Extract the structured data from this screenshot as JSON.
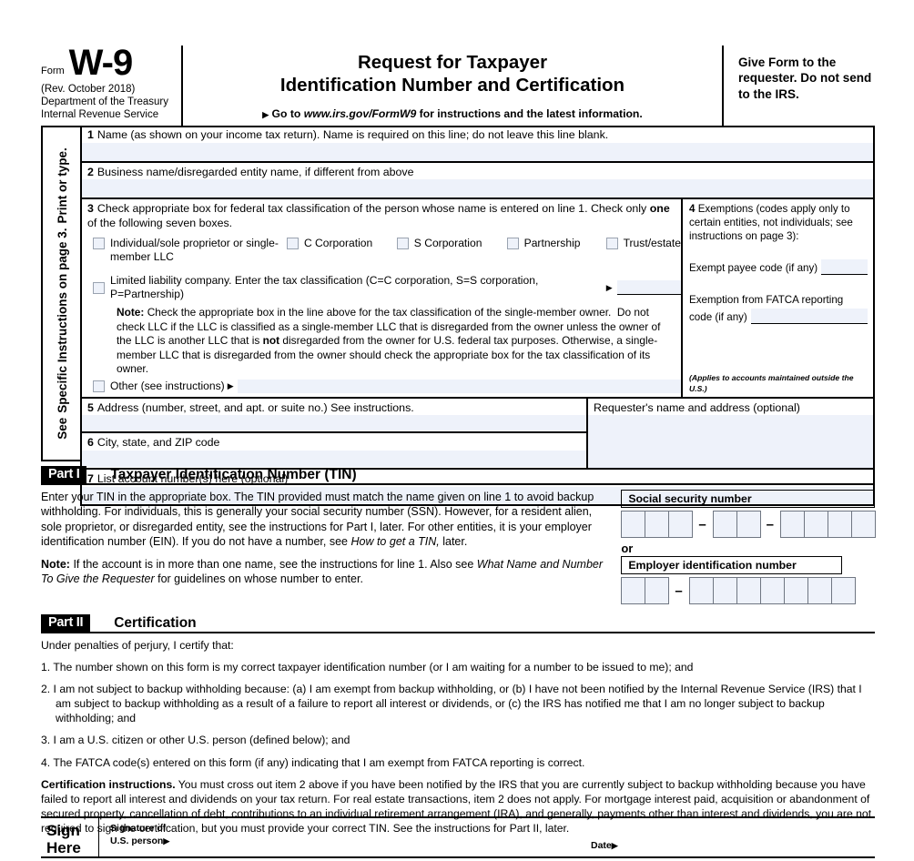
{
  "header": {
    "form_word": "Form",
    "form_number": "W-9",
    "revision": "(Rev. October 2018)",
    "dept_line1": "Department of the Treasury",
    "dept_line2": "Internal Revenue Service",
    "title_line1": "Request for Taxpayer",
    "title_line2": "Identification Number and Certification",
    "goto_prefix": "Go to",
    "goto_url": "www.irs.gov/FormW9",
    "goto_suffix": "for instructions and the latest information.",
    "give_form_note": "Give Form to the requester. Do not send to the IRS."
  },
  "sidebar": {
    "line1": "Print or type.",
    "line2_prefix": "See",
    "line2": "Specific Instructions on page 3."
  },
  "line1": {
    "number": "1",
    "label": "Name (as shown on your income tax return). Name is required on this line; do not leave this line blank.",
    "value": ""
  },
  "line2": {
    "number": "2",
    "label": "Business name/disregarded entity name, if different from above",
    "value": ""
  },
  "line3": {
    "number": "3",
    "label": "Check appropriate box for federal tax classification of the person whose name is entered on line 1. Check only one of the following seven boxes.",
    "label_bold_word": "one",
    "checkboxes": [
      {
        "name": "individual",
        "label": "Individual/sole proprietor or single-member LLC",
        "checked": false
      },
      {
        "name": "c-corporation",
        "label": "C Corporation",
        "checked": false
      },
      {
        "name": "s-corporation",
        "label": "S Corporation",
        "checked": false
      },
      {
        "name": "partnership",
        "label": "Partnership",
        "checked": false
      },
      {
        "name": "trust-estate",
        "label": "Trust/estate",
        "checked": false
      }
    ],
    "llc": {
      "label": "Limited liability company. Enter the tax classification (C=C corporation, S=S corporation, P=Partnership)",
      "checked": false,
      "value": ""
    },
    "note_label": "Note:",
    "note_text": "Check the appropriate box in the line above for the tax classification of the single-member owner.  Do not check LLC if the LLC is classified as a single-member LLC that is disregarded from the owner unless the owner of the LLC is another LLC that is not disregarded from the owner for U.S. federal tax purposes. Otherwise, a single-member LLC that is disregarded from the owner should check the appropriate box for the tax classification of its owner.",
    "other": {
      "label": "Other (see instructions)",
      "checked": false,
      "value": ""
    }
  },
  "line4": {
    "number": "4",
    "label": "Exemptions (codes apply only to certain entities, not individuals; see instructions on page 3):",
    "exempt_payee_label": "Exempt payee code (if any)",
    "exempt_payee_value": "",
    "fatca_label_line1": "Exemption from FATCA reporting",
    "fatca_label_line2": "code (if any)",
    "fatca_value": "",
    "footnote": "(Applies to accounts maintained outside the U.S.)"
  },
  "line5": {
    "number": "5",
    "label": "Address (number, street, and apt. or suite no.) See instructions.",
    "value": ""
  },
  "line6": {
    "number": "6",
    "label": "City, state, and ZIP code",
    "value": ""
  },
  "requester": {
    "label": "Requester's name and address (optional)",
    "value": ""
  },
  "line7": {
    "number": "7",
    "label": "List account number(s) here (optional)",
    "value": ""
  },
  "part1": {
    "tag": "Part I",
    "title": "Taxpayer Identification Number (TIN)",
    "para1": "Enter your TIN in the appropriate box. The TIN provided must match the name given on line 1 to avoid backup withholding. For individuals, this is generally your social security number (SSN). However, for a resident alien, sole proprietor, or disregarded entity, see the instructions for Part I, later. For other entities, it is your employer identification number (EIN). If you do not have a number, see",
    "para1_italic": "How to get a TIN,",
    "para1_tail": "later.",
    "note_label": "Note:",
    "note_text": "If the account is in more than one name, see the instructions for line 1. Also see",
    "note_italic": "What Name and Number To Give the Requester",
    "note_tail": "for guidelines on whose number to enter.",
    "ssn_label": "Social security number",
    "ssn_groups": [
      3,
      2,
      4
    ],
    "ssn_value": "",
    "or_label": "or",
    "ein_label": "Employer identification number",
    "ein_groups": [
      2,
      7
    ],
    "ein_value": "",
    "separator": "–"
  },
  "part2": {
    "tag": "Part II",
    "title": "Certification",
    "intro": "Under penalties of perjury, I certify that:",
    "items": [
      "1. The number shown on this form is my correct taxpayer identification number (or I am waiting for a number to be issued to me); and",
      "2. I am not subject to backup withholding because: (a) I am exempt from backup withholding, or (b) I have not been notified by the Internal Revenue Service (IRS) that I am subject to backup withholding as a result of a failure to report all interest or dividends, or (c) the IRS has notified me that I am no longer subject to backup withholding; and",
      "3. I am a U.S. citizen or other U.S. person (defined below); and",
      "4. The FATCA code(s) entered on this form (if any) indicating that I am exempt from FATCA reporting is correct."
    ],
    "cert_label": "Certification instructions.",
    "cert_text": "You must cross out item 2 above if you have been notified by the IRS that you are currently subject to backup withholding because you have failed to report all interest and dividends on your tax return. For real estate transactions, item 2 does not apply. For mortgage interest paid, acquisition or abandonment of secured property, cancellation of debt, contributions to an individual retirement arrangement (IRA), and generally, payments other than interest and dividends, you are not required to sign the certification, but you must provide your correct TIN. See the instructions for Part II, later."
  },
  "sign": {
    "tag_line1": "Sign",
    "tag_line2": "Here",
    "sig_line1": "Signature of",
    "sig_line2": "U.S. person",
    "date_label": "Date",
    "signature_value": "",
    "date_value": ""
  },
  "colors": {
    "field_fill": "#eef2fa",
    "rule": "#000000",
    "checkbox_border": "#9aa3b0"
  }
}
